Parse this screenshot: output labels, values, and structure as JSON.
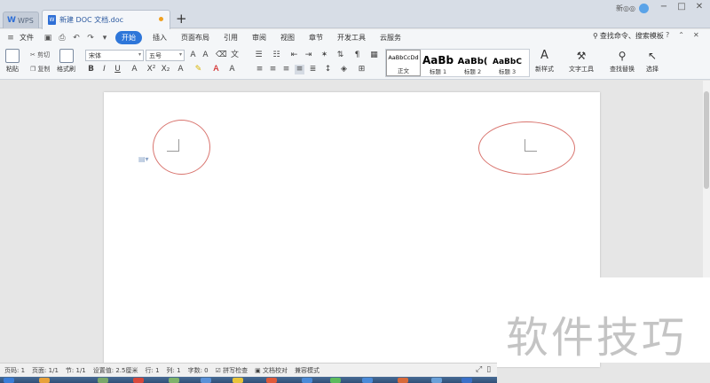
{
  "titlebar": {
    "app_tab": "WPS",
    "doc_tab": "新建 DOC 文档.doc",
    "doc_icon_label": "W",
    "new_tab": "+",
    "user_name": "新◎◎",
    "window_buttons": [
      "−",
      "□",
      "✕"
    ]
  },
  "menubar": {
    "file_menu": "文件",
    "tabs": [
      "开始",
      "插入",
      "页面布局",
      "引用",
      "审阅",
      "视图",
      "章节",
      "开发工具",
      "云服务"
    ],
    "active_tab": "开始",
    "search_placeholder": "查找命令、搜索模板",
    "right_icons": [
      "?",
      "⌃",
      "✕"
    ]
  },
  "ribbon": {
    "paste": "粘贴",
    "cut": "剪切",
    "copy": "复制",
    "format_painter": "格式刷",
    "font_name": "宋体",
    "font_size": "五号",
    "styles": [
      {
        "sample": "AaBbCcDd",
        "label": "正文"
      },
      {
        "sample": "AaBb",
        "label": "标题 1"
      },
      {
        "sample": "AaBb(",
        "label": "标题 2"
      },
      {
        "sample": "AaBbC",
        "label": "标题 3"
      }
    ],
    "new_style": "新样式",
    "text_tools": "文字工具",
    "find_replace": "查找替换",
    "select": "选择"
  },
  "statusbar": {
    "page_num": "页码: 1",
    "pages": "页面: 1/1",
    "section": "节: 1/1",
    "settings": "设置值: 2.5厘米",
    "row": "行: 1",
    "col": "列: 1",
    "word_count": "字数: 0",
    "spell_check": "拼写检查",
    "doc_proof": "文档校对",
    "compat_mode": "兼容模式"
  },
  "watermark": "软件技巧",
  "colors": {
    "accent": "#2e76d9",
    "annotation_circle": "#d9756f"
  }
}
